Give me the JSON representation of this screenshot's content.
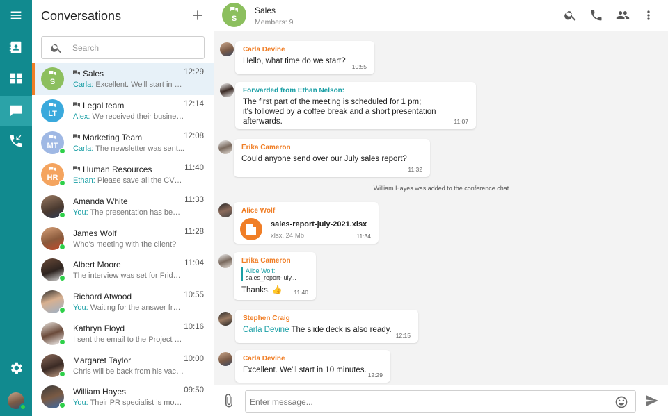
{
  "rail": {
    "items": [
      {
        "icon": "menu-icon"
      },
      {
        "icon": "contacts-icon"
      },
      {
        "icon": "dashboard-icon"
      },
      {
        "icon": "chat-icon",
        "active": true
      },
      {
        "icon": "calls-icon"
      },
      {
        "icon": "settings-icon"
      }
    ]
  },
  "sidebar": {
    "title": "Conversations",
    "search_placeholder": "Search",
    "items": [
      {
        "name": "Sales",
        "time": "12:29",
        "sender": "Carla:",
        "preview": "Excellent. We'll start in 10...",
        "initials": "S",
        "color": "#8cbf5e",
        "group": true,
        "active": true
      },
      {
        "name": "Legal team",
        "time": "12:14",
        "sender": "Alex:",
        "preview": "We received their business...",
        "initials": "LT",
        "color": "#3aa9dc",
        "group": true
      },
      {
        "name": "Marketing Team",
        "time": "12:08",
        "sender": "Carla:",
        "preview": "The newsletter was sent...",
        "initials": "MT",
        "color": "#9fb8e4",
        "group": true,
        "online": true
      },
      {
        "name": "Human Resources",
        "time": "11:40",
        "sender": "Ethan:",
        "preview": "Please save all the CVs in...",
        "initials": "HR",
        "color": "#f4a45f",
        "group": true,
        "online": true
      },
      {
        "name": "Amanda White",
        "time": "11:33",
        "sender": "You:",
        "preview": "The presentation has been...",
        "online": true
      },
      {
        "name": "James Wolf",
        "time": "11:28",
        "sender": "",
        "preview": "Who's meeting with the client?",
        "online": true
      },
      {
        "name": "Albert Moore",
        "time": "11:04",
        "sender": "",
        "preview": "The interview was set for Friday...",
        "online": true
      },
      {
        "name": "Richard Atwood",
        "time": "10:55",
        "sender": "You:",
        "preview": "Waiting for the answer from...",
        "online": true
      },
      {
        "name": "Kathryn Floyd",
        "time": "10:16",
        "sender": "",
        "preview": "I sent the email to the Project Ma...",
        "online": true
      },
      {
        "name": "Margaret Taylor",
        "time": "10:00",
        "sender": "",
        "preview": "Chris will be back from his vaca...",
        "online": true
      },
      {
        "name": "William Hayes",
        "time": "09:50",
        "sender": "You:",
        "preview": "Their PR specialist is most...",
        "online": true
      }
    ]
  },
  "header": {
    "title": "Sales",
    "initials": "S",
    "members": "Members: 9",
    "icons": [
      "search-icon",
      "phone-icon",
      "members-icon",
      "more-vert-icon"
    ]
  },
  "messages": [
    {
      "author": "Carla Devine",
      "text": "Hello, what time do we start?",
      "time": "10:55"
    },
    {
      "author": "Forwarded from Ethan Nelson:",
      "forwarded": true,
      "text": "The first part of the meeting is scheduled for 1 pm;\nit's followed by a coffee break and a short presentation\nafterwards.",
      "time": "11:07"
    },
    {
      "author": "Erika Cameron",
      "text": "Could anyone send over our July sales report?",
      "time": "11:32"
    },
    {
      "system": "William Hayes was added to the conference chat"
    },
    {
      "author": "Alice Wolf",
      "file_name": "sales-report-july-2021.xlsx",
      "file_meta": "xlsx, 24 Mb",
      "time": "11:34"
    },
    {
      "author": "Erika Cameron",
      "quote_author": "Alice Wolf:",
      "quote_text": "sales_report-july...",
      "text": "Thanks. 👍",
      "time": "11:40"
    },
    {
      "author": "Stephen Craig",
      "mention": "Carla Devine",
      "text": " The slide deck is also ready.",
      "time": "12:15"
    },
    {
      "author": "Carla Devine",
      "text": "Excellent. We'll start in 10 minutes.",
      "time": "12:29"
    }
  ],
  "composer": {
    "placeholder": "Enter message...",
    "icons": [
      "attach-icon",
      "emoji-icon",
      "send-icon"
    ]
  },
  "colors": {
    "rail": "#118a8f",
    "accent": "#f07e26",
    "teal_text": "#1a9fa5",
    "online": "#2fd04a"
  }
}
